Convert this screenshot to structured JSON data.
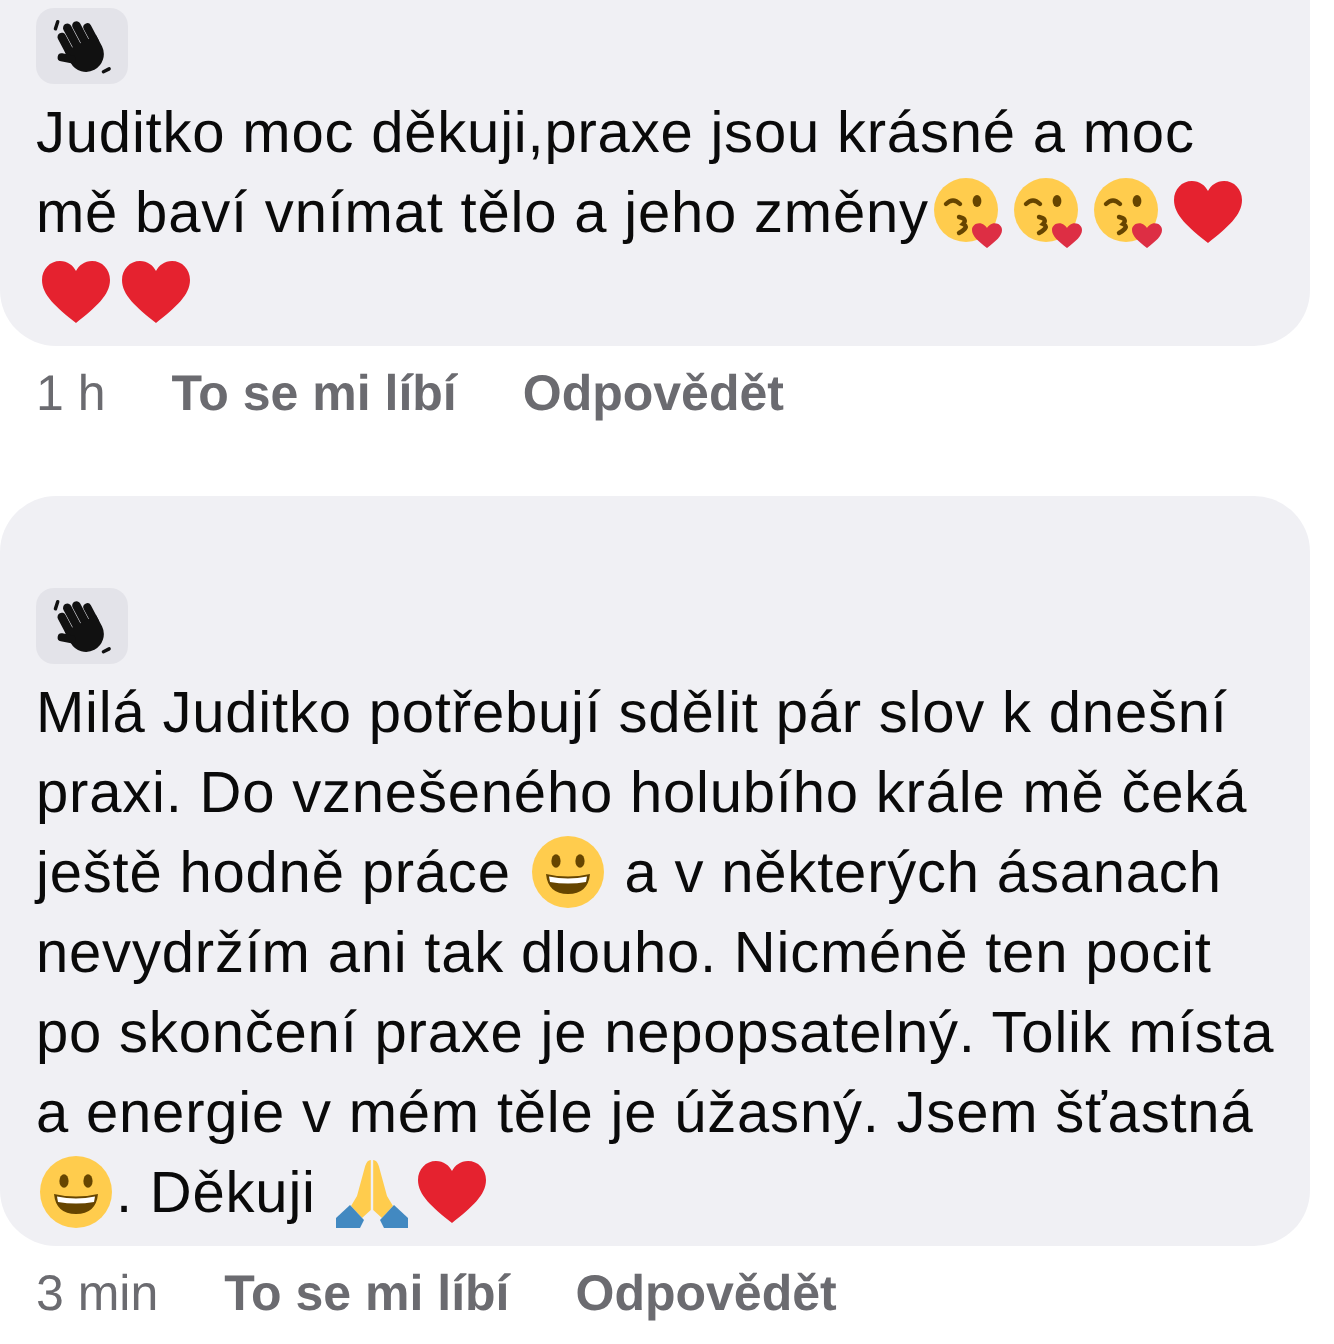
{
  "comments": [
    {
      "lines": [
        [
          {
            "kind": "text",
            "text": "Juditko moc děkuji,praxe jsou krásné a moc"
          }
        ],
        [
          {
            "kind": "text",
            "text": "mě baví vnímat tělo a jeho změny"
          },
          {
            "kind": "kissing_face"
          },
          {
            "kind": "kissing_face"
          },
          {
            "kind": "kissing_face"
          },
          {
            "kind": "heart"
          }
        ],
        [
          {
            "kind": "heart"
          },
          {
            "kind": "heart"
          }
        ]
      ],
      "time": "1 h",
      "actions": [
        "To se mi líbí",
        "Odpovědět"
      ]
    },
    {
      "lines": [
        [
          {
            "kind": "text",
            "text": "Milá Juditko potřebují sdělit pár slov k dnešní"
          }
        ],
        [
          {
            "kind": "text",
            "text": "praxi. Do vznešeného holubího krále mě čeká"
          }
        ],
        [
          {
            "kind": "text",
            "text": "ještě hodně práce "
          },
          {
            "kind": "grinning_face"
          },
          {
            "kind": "text",
            "text": " a v některých ásanach"
          }
        ],
        [
          {
            "kind": "text",
            "text": "nevydržím ani tak dlouho. Nicméně ten pocit"
          }
        ],
        [
          {
            "kind": "text",
            "text": "po skončení praxe je nepopsatelný. Tolik místa"
          }
        ],
        [
          {
            "kind": "text",
            "text": "a energie v mém těle je úžasný. Jsem šťastná"
          }
        ],
        [
          {
            "kind": "grinning_face"
          },
          {
            "kind": "text",
            "text": ". Děkuji "
          },
          {
            "kind": "folded_hands"
          },
          {
            "kind": "heart"
          }
        ]
      ],
      "time": "3 min",
      "actions": [
        "To se mi líbí",
        "Odpovědět"
      ]
    }
  ]
}
